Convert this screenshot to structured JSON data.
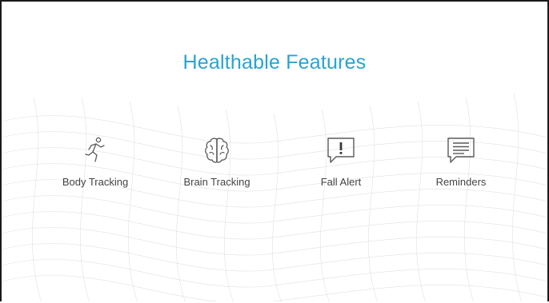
{
  "slide": {
    "title": "Healthable Features",
    "title_color": "#2aa3d0"
  },
  "features": [
    {
      "label": "Body Tracking",
      "icon": "running-person-icon"
    },
    {
      "label": "Brain Tracking",
      "icon": "brain-icon"
    },
    {
      "label": "Fall Alert",
      "icon": "alert-speech-bubble-icon"
    },
    {
      "label": "Reminders",
      "icon": "message-lines-icon"
    }
  ]
}
